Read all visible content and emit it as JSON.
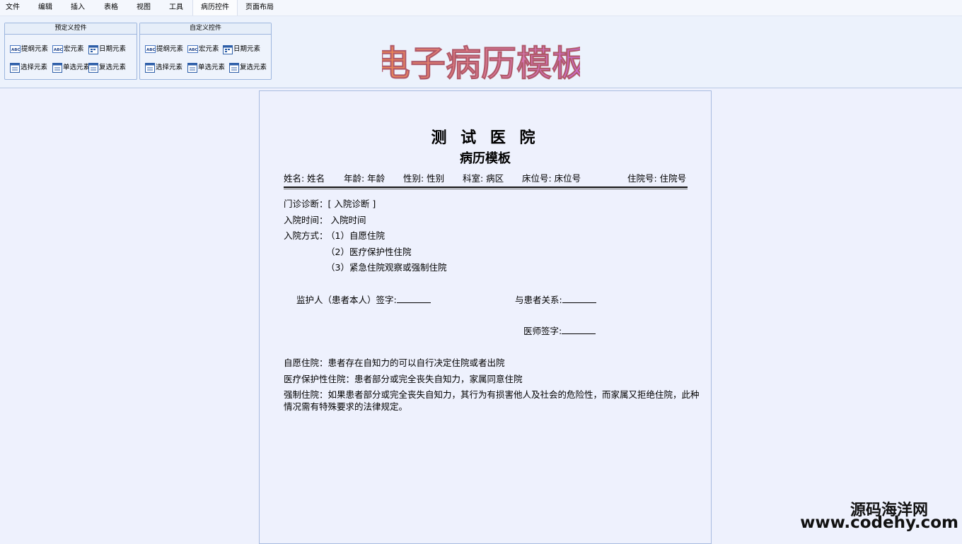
{
  "menu": {
    "items": [
      "文件",
      "编辑",
      "插入",
      "表格",
      "视图",
      "工具",
      "病历控件",
      "页面布局"
    ],
    "active_index": 6
  },
  "ribbon": {
    "predefined": {
      "title": "预定义控件",
      "buttons": [
        {
          "label": "提纲元素",
          "icon": "abc-field-icon"
        },
        {
          "label": "宏元素",
          "icon": "abc-field-icon"
        },
        {
          "label": "日期元素",
          "icon": "date-field-icon"
        },
        {
          "label": "选择元素",
          "icon": "select-field-icon"
        },
        {
          "label": "单选元素",
          "icon": "select-field-icon"
        },
        {
          "label": "复选元素",
          "icon": "select-field-icon"
        }
      ]
    },
    "custom": {
      "title": "自定义控件",
      "buttons": [
        {
          "label": "提纲元素",
          "icon": "abc-field-icon"
        },
        {
          "label": "宏元素",
          "icon": "abc-field-icon"
        },
        {
          "label": "日期元素",
          "icon": "date-field-icon"
        },
        {
          "label": "选择元素",
          "icon": "select-field-icon"
        },
        {
          "label": "单选元素",
          "icon": "select-field-icon"
        },
        {
          "label": "复选元素",
          "icon": "select-field-icon"
        }
      ]
    },
    "banner_text": "电子病历模板",
    "banner_colors": [
      "#f08a4a",
      "#c86ad8"
    ]
  },
  "document": {
    "hospital_name": "测 试 医 院",
    "subtitle": "病历模板",
    "header_fields": {
      "name": "姓名: 姓名",
      "age": "年龄: 年龄",
      "gender": "性别: 性别",
      "department": "科室: 病区",
      "bed": "床位号: 床位号",
      "admission_no": "住院号: 住院号"
    },
    "outpatient_diagnosis": "门诊诊断：[ 入院诊断 ]",
    "admission_time": "入院时间： 入院时间",
    "admission_mode_label": "入院方式：",
    "admission_modes": [
      "（1）自愿住院",
      "（2）医疗保护性住院",
      "（3）紧急住院观察或强制住院"
    ],
    "guardian_signature": "监护人（患者本人）签字:",
    "relation": "与患者关系:",
    "doctor_signature": "医师签字:",
    "notes": [
      "自愿住院：患者存在自知力的可以自行决定住院或者出院",
      "医疗保护性住院：患者部分或完全丧失自知力，家属同意住院",
      "强制住院：如果患者部分或完全丧失自知力，其行为有损害他人及社会的危险性，而家属又拒绝住院，此种",
      "情况需有特殊要求的法律规定。"
    ]
  },
  "watermark": {
    "line1": "源码海洋网",
    "line2": "www.codehy.com"
  }
}
